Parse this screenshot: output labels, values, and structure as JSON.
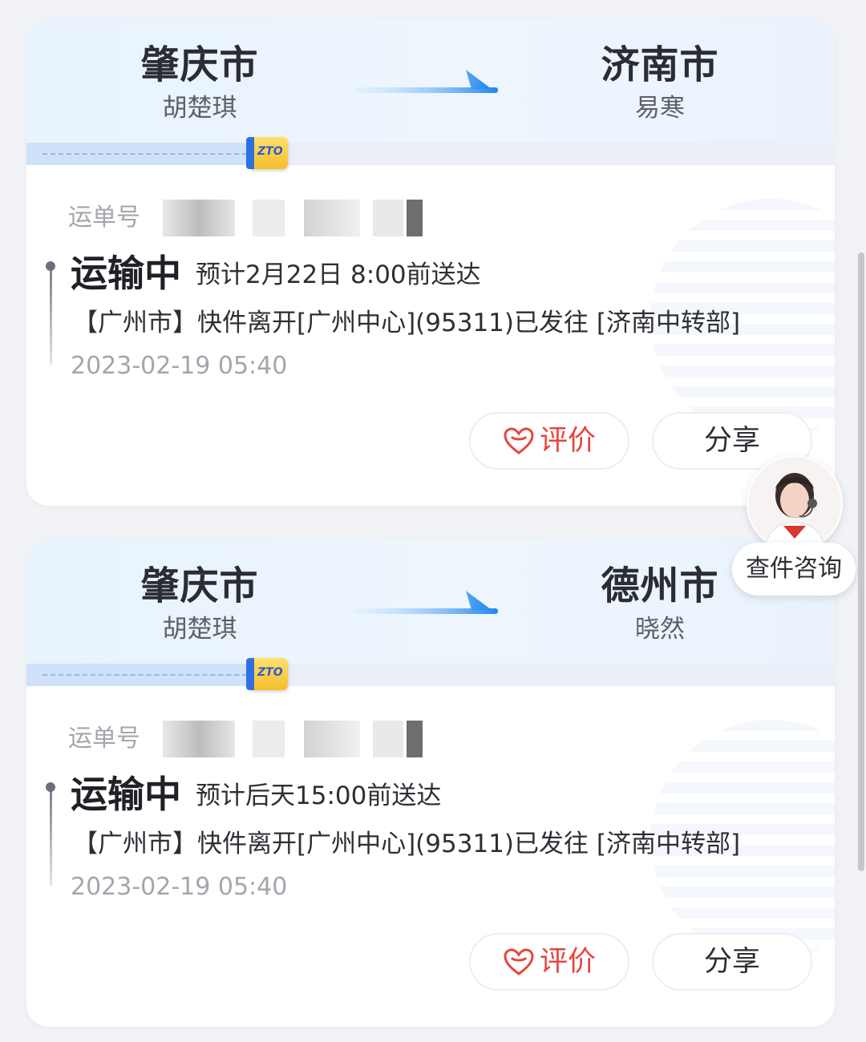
{
  "cards": [
    {
      "from_city": "肇庆市",
      "from_person": "胡楚琪",
      "to_city": "济南市",
      "to_person": "易寒",
      "carrier_logo": "ZTO",
      "waybill_label": "运单号",
      "status": "运输中",
      "eta": "预计2月22日 8:00前送达",
      "detail": "【广州市】快件离开[广州中心](95311)已发往 [济南中转部]",
      "time": "2023-02-19 05:40",
      "rate_label": "评价",
      "share_label": "分享"
    },
    {
      "from_city": "肇庆市",
      "from_person": "胡楚琪",
      "to_city": "德州市",
      "to_person": "晓然",
      "carrier_logo": "ZTO",
      "waybill_label": "运单号",
      "status": "运输中",
      "eta": "预计后天15:00前送达",
      "detail": "【广州市】快件离开[广州中心](95311)已发往 [济南中转部]",
      "time": "2023-02-19 05:40",
      "rate_label": "评价",
      "share_label": "分享"
    }
  ],
  "support": {
    "label": "查件咨询"
  },
  "colors": {
    "accent_blue": "#2f8cf0",
    "rate_red": "#e8453c",
    "route_bg": "#e8f3fd"
  },
  "icons": {
    "route_arrow": "arrow-right-icon",
    "parcel": "zto-box-icon",
    "rate": "flower-heart-icon"
  }
}
